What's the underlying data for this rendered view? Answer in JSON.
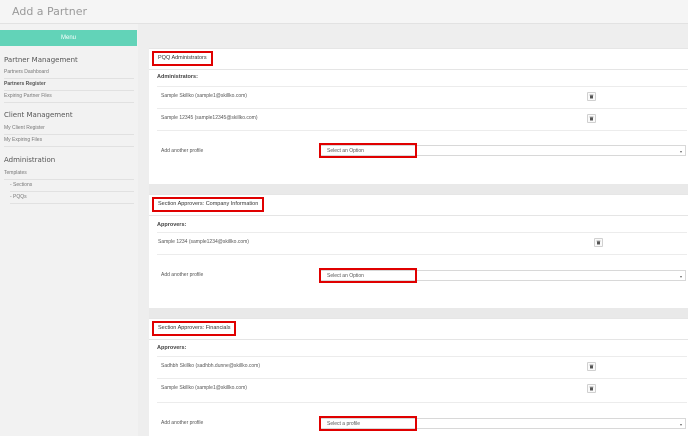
{
  "page": {
    "title": "Add a Partner"
  },
  "sidebar": {
    "menu_label": "Menu",
    "groups": [
      {
        "heading": "Partner Management",
        "items": [
          {
            "label": "Partners Dashboard"
          },
          {
            "label": "Partners Register"
          },
          {
            "label": "Expiring Partner Files"
          }
        ]
      },
      {
        "heading": "Client Management",
        "items": [
          {
            "label": "My Client Register"
          },
          {
            "label": "My Expiring Files"
          }
        ]
      },
      {
        "heading": "Administration",
        "items": [
          {
            "label": "Templates"
          },
          {
            "label": "- Sections"
          },
          {
            "label": "- PQQs"
          }
        ]
      }
    ]
  },
  "sections": [
    {
      "title": "PQQ Administrators",
      "subheading": "Administrators:",
      "rows": [
        "Sample Skillko (sample1@skillko.com)",
        "Sample 12345 (sample12345@skillko.com)"
      ],
      "add_label": "Add another profile",
      "select_value": "Select an Option"
    },
    {
      "title": "Section Approvers: Company Information",
      "subheading": "Approvers:",
      "rows": [
        "Sample 1234 (sample1234@skillko.com)"
      ],
      "add_label": "Add another profile",
      "select_value": "Select an Option"
    },
    {
      "title": "Section Approvers: Financials",
      "subheading": "Approvers:",
      "rows": [
        "Sadhbh Skillko (sadhbh.dunne@skillko.com)",
        "Sample Skillko (sample1@skillko.com)"
      ],
      "add_label": "Add another profile",
      "select_value": "Select a profile"
    }
  ],
  "colors": {
    "menu_accent": "#62d3b8",
    "highlight": "#e00000"
  },
  "icons": {
    "remove": "trash-icon",
    "dropdown": "chevron-down-icon"
  }
}
